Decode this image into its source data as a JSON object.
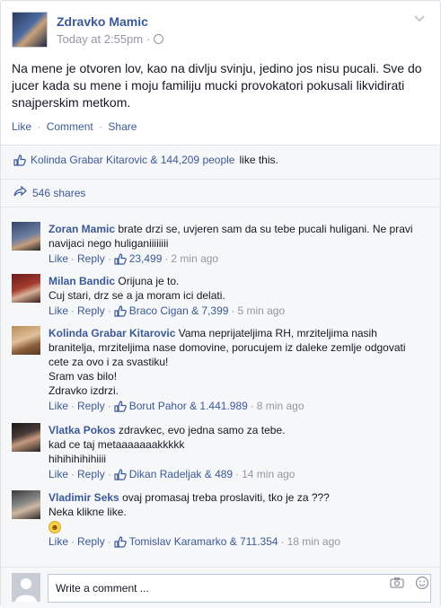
{
  "post": {
    "author": "Zdravko Mamic",
    "timestamp": "Today at 2:55pm",
    "meta_sep": "·",
    "text": "Na mene je otvoren lov, kao na divlju svinju, jedino jos nisu pucali. Sve do jucer kada su mene i moju familiju mucki provokatori pokusali likvidirati snajperskim metkom.",
    "actions": {
      "like": "Like",
      "comment": "Comment",
      "share": "Share",
      "sep": "·"
    },
    "likes": {
      "names": "Kolinda Grabar Kitarovic & 144,209 people",
      "suffix": "like this."
    },
    "shares": "546 shares"
  },
  "comments": [
    {
      "author": "Zoran Mamic",
      "lines": [
        "brate drzi se, uvjeren sam da su tebe pucali huligani. Ne pravi",
        "navijaci nego huliganiiiiiiii"
      ],
      "likes": "23,499",
      "time": "2 min ago"
    },
    {
      "author": "Milan Bandic",
      "lines": [
        "Orijuna je to.",
        "Cuj stari, drz se a ja moram ici delati."
      ],
      "likes": "Braco Cigan & 7,399",
      "time": "5 min ago"
    },
    {
      "author": "Kolinda Grabar Kitarovic",
      "lines": [
        "Vama neprijateljima RH, mrziteljima nasih",
        "branitelja, mrziteljima nase domovine, porucujem iz daleke zemlje odgovati",
        "cete za ovo i za svastiku!",
        "Sram vas bilo!",
        "Zdravko izdrzi."
      ],
      "likes": "Borut Pahor & 1.441.989",
      "time": "8 min ago"
    },
    {
      "author": "Vlatka Pokos",
      "lines": [
        "zdravkec, evo jedna samo za tebe.",
        "kad ce taj metaaaaaaakkkkk",
        "hihihihihihiiii"
      ],
      "likes": "Dikan Radeljak & 489",
      "time": "14 min ago"
    },
    {
      "author": "Vladimir Seks",
      "lines": [
        "ovaj promasaj treba proslaviti, tko je za ???",
        "Neka klikne like."
      ],
      "likes": "Tomislav Karamarko & 711.354",
      "time": "18 min ago"
    }
  ],
  "comment_actions": {
    "like": "Like",
    "reply": "Reply",
    "sep": "·"
  },
  "composer": {
    "placeholder": "Write a comment ..."
  },
  "icons": {
    "chevron": "chevron-down-icon",
    "globe": "globe-icon",
    "thumb": "thumbs-up-icon",
    "share": "share-arrow-icon",
    "camera": "camera-icon",
    "smile": "smiley-icon",
    "emoji": "smiley-emoji-icon"
  },
  "colors": {
    "link": "#3b5998",
    "meta": "#9197a3",
    "bar": "#f6f7f8"
  }
}
